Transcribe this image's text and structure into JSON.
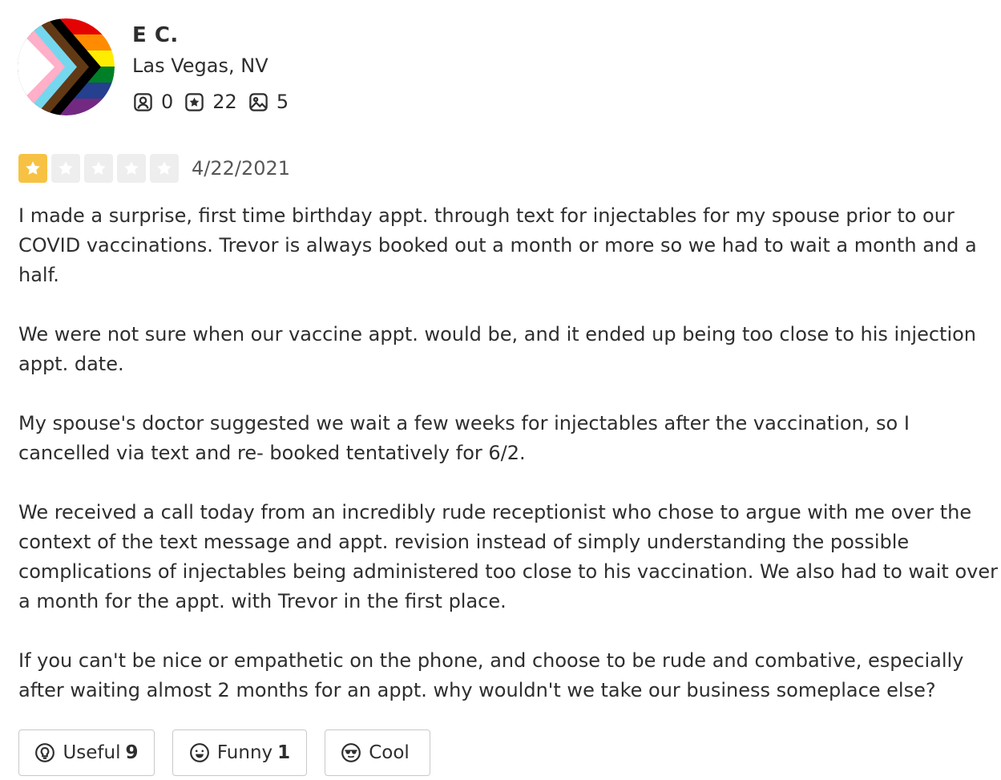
{
  "user": {
    "name": "E C.",
    "location": "Las Vegas, NV",
    "stats": {
      "friends": "0",
      "reviews": "22",
      "photos": "5"
    }
  },
  "review": {
    "rating": 1,
    "max_rating": 5,
    "date": "4/22/2021",
    "paragraphs": [
      "I made a surprise, first time birthday appt. through text for injectables for my spouse prior to our COVID vaccinations. Trevor is always booked out a month or more so we had to wait a month and a half.",
      "We were not sure when our vaccine appt. would  be, and it ended up being too close to his injection appt. date.",
      "My spouse's doctor suggested we wait a few weeks for injectables after the vaccination, so I cancelled via text and re- booked tentatively for 6/2.",
      "We received a call today from an incredibly rude receptionist who chose to argue with me over the context of the text message and appt. revision instead of simply understanding the possible complications of injectables being administered too close to his vaccination. We also had to wait over a month for the appt. with Trevor in the first place.",
      "If you can't be nice or empathetic on the phone, and choose to be rude and combative, especially after waiting almost 2 months for an appt. why wouldn't we take our business someplace else?"
    ]
  },
  "actions": {
    "useful_label": "Useful",
    "useful_count": "9",
    "funny_label": "Funny",
    "funny_count": "1",
    "cool_label": "Cool",
    "cool_count": ""
  },
  "colors": {
    "star_on": "#f7c243",
    "star_off": "#eeeeef",
    "text": "#2d2e2f",
    "muted": "#555759",
    "border": "#c8c9ca"
  },
  "icons": {
    "friends": "friends-icon",
    "reviews": "star-badge-icon",
    "photos": "photo-icon",
    "useful": "lightbulb-icon",
    "funny": "smile-icon",
    "cool": "sunglasses-icon"
  }
}
